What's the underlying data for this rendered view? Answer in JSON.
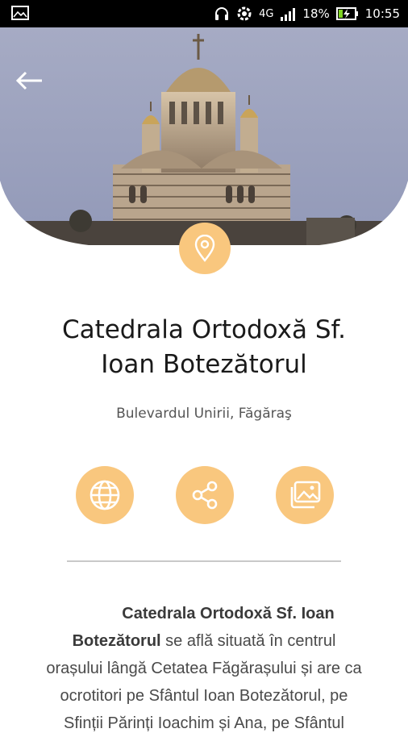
{
  "status_bar": {
    "network": "4G",
    "battery": "18%",
    "time": "10:55"
  },
  "header": {
    "back_icon": "arrow-left-icon"
  },
  "place": {
    "pin_icon": "location-pin-icon",
    "title_line1": "Catedrala Ortodoxă Sf.",
    "title_line2": "Ioan Botezătorul",
    "address": "Bulevardul Unirii, Făgăraş"
  },
  "actions": [
    {
      "name": "website",
      "icon": "globe-icon"
    },
    {
      "name": "share",
      "icon": "share-icon"
    },
    {
      "name": "gallery",
      "icon": "photo-gallery-icon"
    }
  ],
  "description": {
    "bold_name_part1": "Catedrala Ortodoxă Sf. Ioan",
    "bold_name_part2": "Botezătorul",
    "text_part1": " se află situată în centrul",
    "line3": "orașului lângă Cetatea Făgărașului și are ca",
    "line4": "ocrotitori pe Sfântul Ioan Botezătorul, pe",
    "line5": "Sfinții Părinți Ioachim și Ana, pe Sfântul"
  },
  "colors": {
    "accent": "#f9c77e",
    "sky": "#9fa6c0",
    "status_bar": "#000000"
  }
}
